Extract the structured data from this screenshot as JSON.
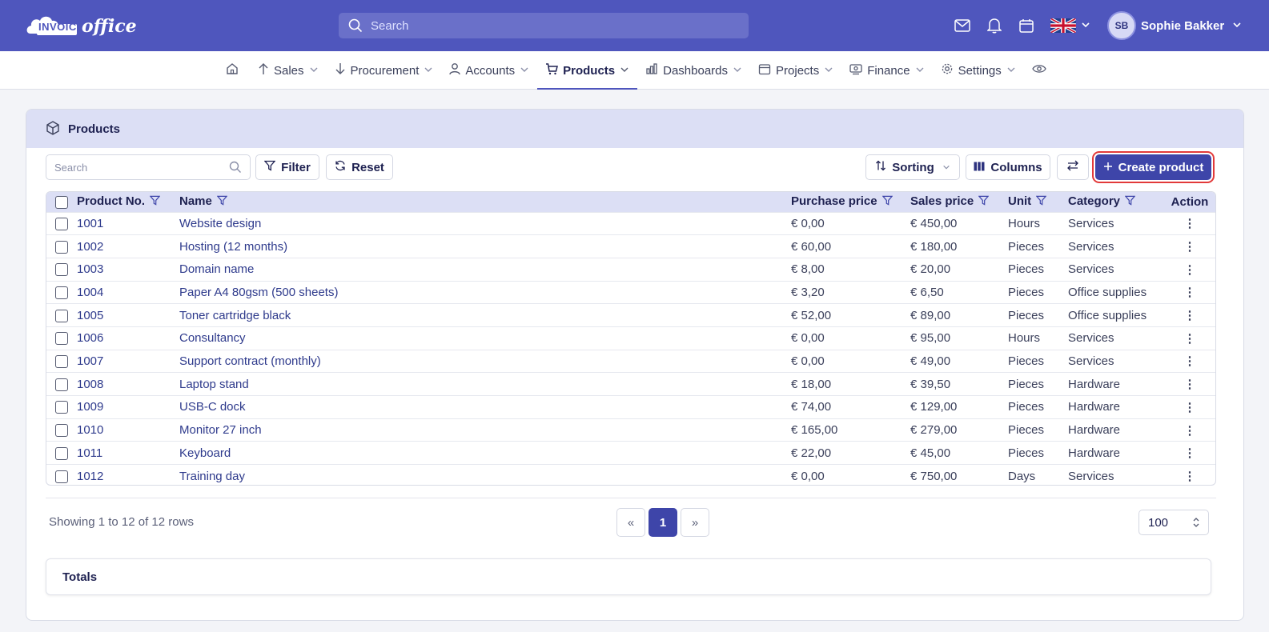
{
  "app": {
    "logo_text_1": "INVOICE",
    "logo_text_2": "office",
    "search_placeholder": "Search",
    "user_initials": "SB",
    "user_name": "Sophie Bakker",
    "accent": "#4f56bd"
  },
  "nav": {
    "home_icon": "home-icon",
    "items": [
      {
        "label": "Sales",
        "icon": "arrow-up-icon"
      },
      {
        "label": "Procurement",
        "icon": "arrow-down-icon"
      },
      {
        "label": "Accounts",
        "icon": "person-icon"
      },
      {
        "label": "Products",
        "icon": "cart-icon",
        "active": true
      },
      {
        "label": "Dashboards",
        "icon": "bar-chart-icon"
      },
      {
        "label": "Projects",
        "icon": "calendar-icon"
      },
      {
        "label": "Finance",
        "icon": "money-icon"
      },
      {
        "label": "Settings",
        "icon": "gear-icon"
      }
    ]
  },
  "card": {
    "title": "Products"
  },
  "toolbar": {
    "search_placeholder": "Search",
    "filter_label": "Filter",
    "reset_label": "Reset",
    "sorting_label": "Sorting",
    "columns_label": "Columns",
    "create_label": "Create product"
  },
  "table": {
    "headers": {
      "product_no": "Product No.",
      "name": "Name",
      "purchase_price": "Purchase price",
      "sales_price": "Sales price",
      "unit": "Unit",
      "category": "Category",
      "action": "Action"
    },
    "rows": [
      {
        "no": "1001",
        "name": "Website design",
        "purchase": "€ 0,00",
        "sales": "€ 450,00",
        "unit": "Hours",
        "category": "Services"
      },
      {
        "no": "1002",
        "name": "Hosting (12 months)",
        "purchase": "€ 60,00",
        "sales": "€ 180,00",
        "unit": "Pieces",
        "category": "Services"
      },
      {
        "no": "1003",
        "name": "Domain name",
        "purchase": "€ 8,00",
        "sales": "€ 20,00",
        "unit": "Pieces",
        "category": "Services"
      },
      {
        "no": "1004",
        "name": "Paper A4 80gsm (500 sheets)",
        "purchase": "€ 3,20",
        "sales": "€ 6,50",
        "unit": "Pieces",
        "category": "Office supplies"
      },
      {
        "no": "1005",
        "name": "Toner cartridge black",
        "purchase": "€ 52,00",
        "sales": "€ 89,00",
        "unit": "Pieces",
        "category": "Office supplies"
      },
      {
        "no": "1006",
        "name": "Consultancy",
        "purchase": "€ 0,00",
        "sales": "€ 95,00",
        "unit": "Hours",
        "category": "Services"
      },
      {
        "no": "1007",
        "name": "Support contract (monthly)",
        "purchase": "€ 0,00",
        "sales": "€ 49,00",
        "unit": "Pieces",
        "category": "Services"
      },
      {
        "no": "1008",
        "name": "Laptop stand",
        "purchase": "€ 18,00",
        "sales": "€ 39,50",
        "unit": "Pieces",
        "category": "Hardware"
      },
      {
        "no": "1009",
        "name": "USB-C dock",
        "purchase": "€ 74,00",
        "sales": "€ 129,00",
        "unit": "Pieces",
        "category": "Hardware"
      },
      {
        "no": "1010",
        "name": "Monitor 27 inch",
        "purchase": "€ 165,00",
        "sales": "€ 279,00",
        "unit": "Pieces",
        "category": "Hardware"
      },
      {
        "no": "1011",
        "name": "Keyboard",
        "purchase": "€ 22,00",
        "sales": "€ 45,00",
        "unit": "Pieces",
        "category": "Hardware"
      },
      {
        "no": "1012",
        "name": "Training day",
        "purchase": "€ 0,00",
        "sales": "€ 750,00",
        "unit": "Days",
        "category": "Services"
      }
    ]
  },
  "footer": {
    "rows_info": "Showing 1 to 12 of 12 rows",
    "prev": "«",
    "page": "1",
    "next": "»",
    "page_size": "100",
    "totals_label": "Totals"
  }
}
